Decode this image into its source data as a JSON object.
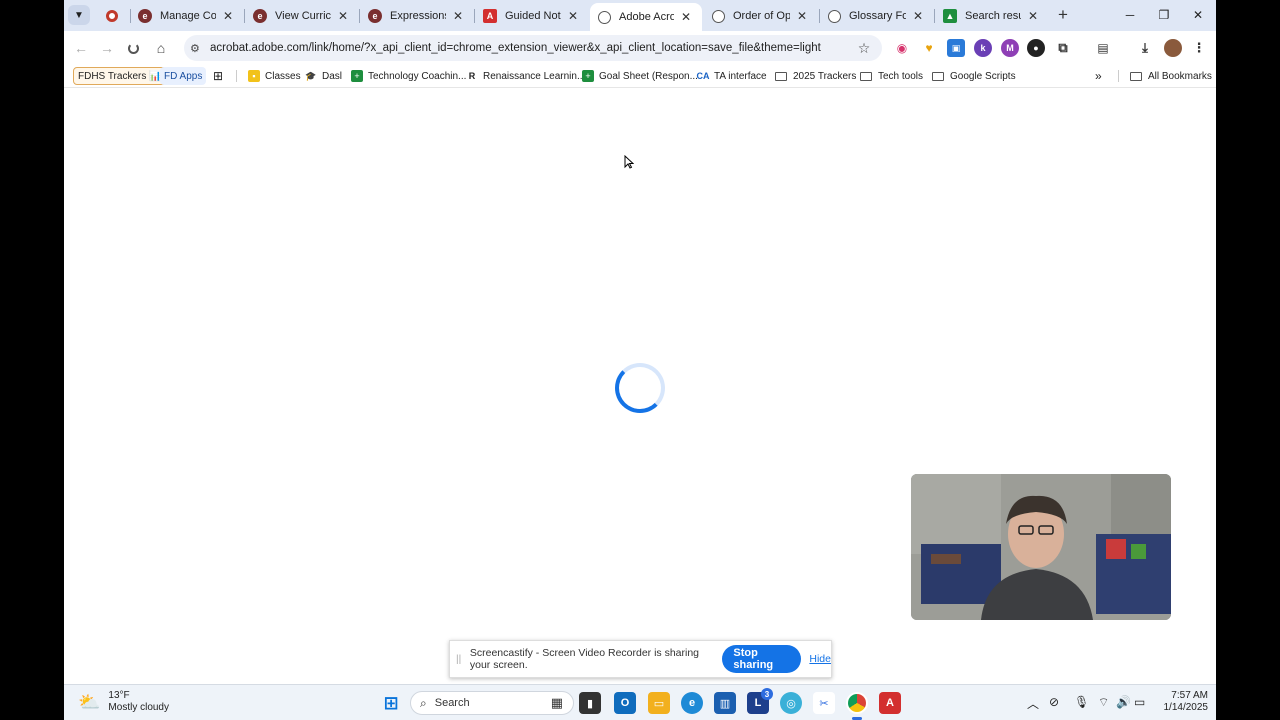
{
  "tabs": [
    {
      "title": "",
      "icon": "target-icon",
      "color": "#c0392b"
    },
    {
      "title": "Manage Courses",
      "icon": "e-logo-icon",
      "color": "#7a2f2f"
    },
    {
      "title": "View Curriculum",
      "icon": "e-logo-icon",
      "color": "#7a2f2f"
    },
    {
      "title": "Expressions: Tu",
      "icon": "e-logo-icon",
      "color": "#7a2f2f"
    },
    {
      "title": "Guided Notes -",
      "icon": "pdf-icon",
      "color": "#d32f2f"
    },
    {
      "title": "Adobe Acrobat",
      "icon": "globe-icon",
      "color": "#555555",
      "active": true
    },
    {
      "title": "Order of Opera",
      "icon": "globe-icon",
      "color": "#555555"
    },
    {
      "title": "Glossary For Of",
      "icon": "globe-icon",
      "color": "#555555"
    },
    {
      "title": "Search results",
      "icon": "drive-icon",
      "color": "#1e8e3e"
    }
  ],
  "address_bar": {
    "url": "acrobat.adobe.com/link/home/?x_api_client_id=chrome_extension_viewer&x_api_client_location=save_file&theme=light"
  },
  "bookmarks": [
    {
      "label": "FDHS Trackers 📊",
      "icon": "",
      "style": "pill"
    },
    {
      "label": "FD Apps",
      "icon": "",
      "style": "pill2"
    },
    {
      "label": "",
      "icon": "apps-grid-icon"
    },
    {
      "label": "Classes",
      "icon": "classroom-icon"
    },
    {
      "label": "Dasl",
      "icon": "cap-icon"
    },
    {
      "label": "Technology Coachin...",
      "icon": "sheets-icon"
    },
    {
      "label": "Renaissance Learnin...",
      "icon": "renaissance-icon"
    },
    {
      "label": "Goal Sheet (Respon...",
      "icon": "sheets-icon"
    },
    {
      "label": "TA interface",
      "icon": "ta-icon"
    },
    {
      "label": "2025 Trackers",
      "icon": "folder-icon"
    },
    {
      "label": "Tech tools",
      "icon": "folder-icon"
    },
    {
      "label": "Google Scripts",
      "icon": "folder-icon"
    }
  ],
  "all_bookmarks_label": "All Bookmarks",
  "share_bar": {
    "message": "Screencastify - Screen Video Recorder is sharing your screen.",
    "stop_label": "Stop sharing",
    "hide_label": "Hide"
  },
  "taskbar": {
    "weather_temp": "13°F",
    "weather_desc": "Mostly cloudy",
    "search_label": "Search",
    "time": "7:57 AM",
    "date": "1/14/2025",
    "notification_count": "3"
  }
}
